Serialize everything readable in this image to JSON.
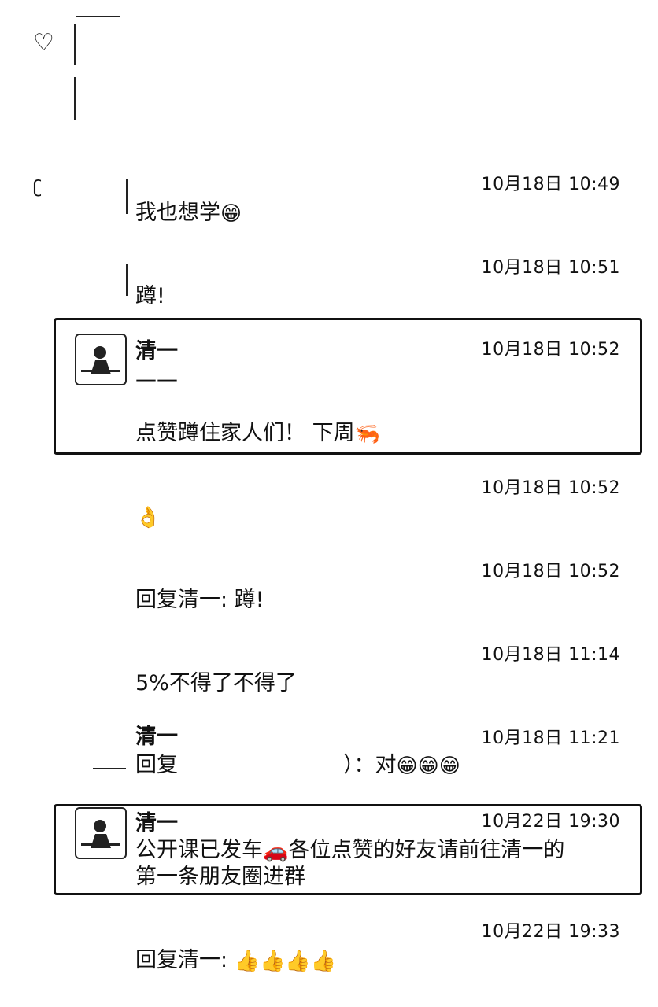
{
  "like_icon": "heart-icon",
  "items": [
    {
      "id": "m1",
      "name": "",
      "time": "10月18日 10:49",
      "text": "我也想学",
      "emoji": "😁"
    },
    {
      "id": "m2",
      "name": "",
      "time": "10月18日 10:51",
      "text": "蹲!",
      "emoji": ""
    },
    {
      "id": "m3",
      "name": "清一",
      "time": "10月18日 10:52",
      "line1": "——",
      "text": "点赞蹲住家人们！ 下周",
      "emoji": "🦐"
    },
    {
      "id": "m4",
      "name": "",
      "time": "10月18日 10:52",
      "text": "",
      "emoji": "👌"
    },
    {
      "id": "m5",
      "name": "",
      "time": "10月18日 10:52",
      "text": "回复清一: 蹲!",
      "emoji": ""
    },
    {
      "id": "m6",
      "name": "",
      "time": "10月18日 11:14",
      "text": "5%不得了不得了",
      "emoji": ""
    },
    {
      "id": "m7",
      "name": "清一",
      "time": "10月18日 11:21",
      "text_a": "回复",
      "text_b": "）：对",
      "emoji": "😁😁😁"
    },
    {
      "id": "m8",
      "name": "清一",
      "time": "10月22日 19:30",
      "text_a": "公开课已发车",
      "emoji": "🚗",
      "text_b": "各位点赞的好友请前往清一的",
      "text_c": "第一条朋友圈进群"
    },
    {
      "id": "m9",
      "name": "",
      "time": "10月22日 19:33",
      "text": "回复清一: ",
      "emoji": "👍👍👍👍"
    }
  ]
}
